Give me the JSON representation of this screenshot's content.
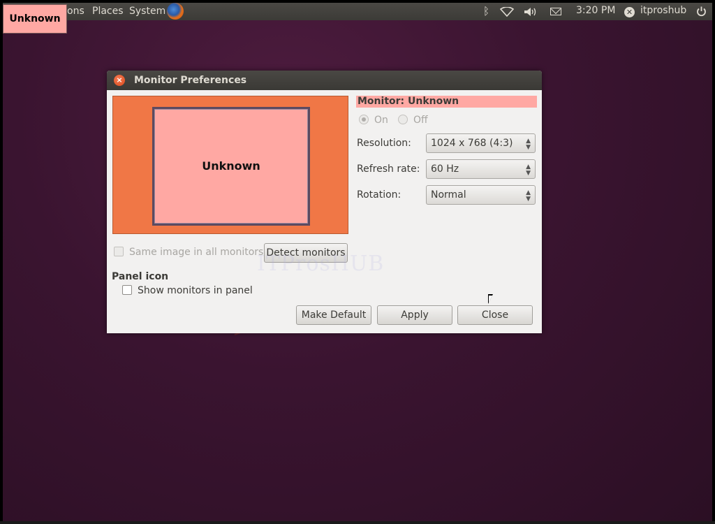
{
  "top_panel": {
    "menu_applications": "ons",
    "menu_places": "Places",
    "menu_system": "System",
    "browser_icon": "firefox-icon",
    "tray_icons": [
      "bluetooth-icon",
      "wifi-icon",
      "volume-icon",
      "mail-icon"
    ],
    "clock": "3:20 PM",
    "username": "itproshub",
    "power_icon": "power-icon"
  },
  "monitor_label": "Unknown",
  "dialog": {
    "title": "Monitor Preferences",
    "preview_monitor_name": "Unknown",
    "monitor_heading": "Monitor: Unknown",
    "power": {
      "on_label": "On",
      "off_label": "Off",
      "selected": "On"
    },
    "resolution": {
      "label": "Resolution:",
      "value": "1024 x 768 (4:3)"
    },
    "refresh_rate": {
      "label": "Refresh rate:",
      "value": "60 Hz"
    },
    "rotation": {
      "label": "Rotation:",
      "value": "Normal"
    },
    "same_image_label": "Same image in all monitors",
    "detect_monitors_label": "Detect monitors",
    "panel_icon_heading": "Panel icon",
    "show_monitors_label": "Show monitors in panel",
    "buttons": {
      "make_default": "Make Default",
      "apply": "Apply",
      "close": "Close"
    }
  },
  "watermark": "ITProsHUB",
  "colors": {
    "desktop": "#3a1430",
    "panel": "#3c3b37",
    "preview_bg": "#f07746",
    "monitor_fill": "#ffa8a3",
    "dialog_bg": "#f2f1f0"
  }
}
